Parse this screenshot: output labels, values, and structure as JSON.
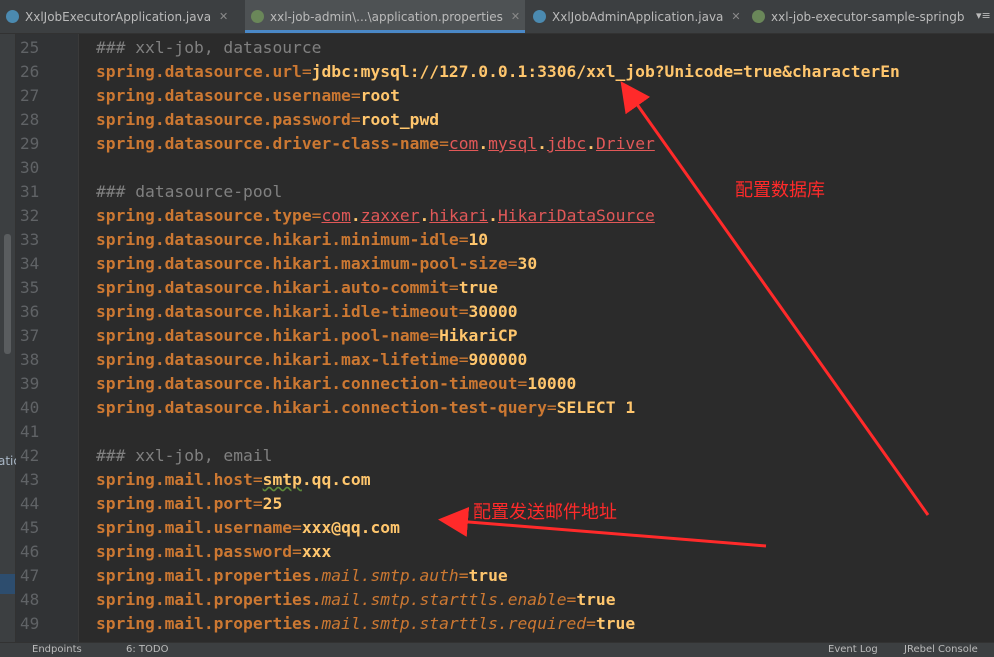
{
  "tabs": [
    {
      "label": "XxlJobExecutorApplication.java",
      "icon": "java-class-icon",
      "active": false
    },
    {
      "label": "xxl-job-admin\\...\\application.properties",
      "icon": "properties-file-icon",
      "active": true
    },
    {
      "label": "XxlJobAdminApplication.java",
      "icon": "java-class-icon",
      "active": false
    },
    {
      "label": "xxl-job-executor-sample-springb",
      "icon": "properties-file-icon",
      "active": false
    }
  ],
  "colors": {
    "annotation": "#ff2a2a",
    "key": "#cc7832",
    "value": "#ffc66d",
    "comment": "#808080",
    "error_ref": "#e15858"
  },
  "side_text": "atic",
  "lines": [
    {
      "no": "25",
      "parts": [
        {
          "cls": "c",
          "t": "### xxl-job, datasource"
        }
      ]
    },
    {
      "no": "26",
      "parts": [
        {
          "cls": "k",
          "t": "spring.datasource.url"
        },
        {
          "cls": "eq",
          "t": "="
        },
        {
          "cls": "v",
          "t": "jdbc:mysql://127.0.0.1:3306/xxl_job?Unicode=true&characterEn"
        }
      ]
    },
    {
      "no": "27",
      "parts": [
        {
          "cls": "k",
          "t": "spring.datasource.username"
        },
        {
          "cls": "eq",
          "t": "="
        },
        {
          "cls": "v",
          "t": "root"
        }
      ]
    },
    {
      "no": "28",
      "parts": [
        {
          "cls": "k",
          "t": "spring.datasource.password"
        },
        {
          "cls": "eq",
          "t": "="
        },
        {
          "cls": "v",
          "t": "root_pwd"
        }
      ]
    },
    {
      "no": "29",
      "parts": [
        {
          "cls": "k",
          "t": "spring.datasource.driver-class-name"
        },
        {
          "cls": "eq",
          "t": "="
        },
        {
          "cls": "err",
          "t": "com"
        },
        {
          "cls": "v",
          "t": "."
        },
        {
          "cls": "err",
          "t": "mysql"
        },
        {
          "cls": "v",
          "t": "."
        },
        {
          "cls": "err",
          "t": "jdbc"
        },
        {
          "cls": "v",
          "t": "."
        },
        {
          "cls": "err",
          "t": "Driver"
        }
      ]
    },
    {
      "no": "30",
      "parts": []
    },
    {
      "no": "31",
      "parts": [
        {
          "cls": "c",
          "t": "### datasource-pool"
        }
      ]
    },
    {
      "no": "32",
      "parts": [
        {
          "cls": "k",
          "t": "spring.datasource.type"
        },
        {
          "cls": "eq",
          "t": "="
        },
        {
          "cls": "err",
          "t": "com"
        },
        {
          "cls": "v",
          "t": "."
        },
        {
          "cls": "err",
          "t": "zaxxer"
        },
        {
          "cls": "v",
          "t": "."
        },
        {
          "cls": "err",
          "t": "hikari"
        },
        {
          "cls": "v",
          "t": "."
        },
        {
          "cls": "err",
          "t": "HikariDataSource"
        }
      ]
    },
    {
      "no": "33",
      "parts": [
        {
          "cls": "k",
          "t": "spring.datasource.hikari.minimum-idle"
        },
        {
          "cls": "eq",
          "t": "="
        },
        {
          "cls": "v",
          "t": "10"
        }
      ]
    },
    {
      "no": "34",
      "parts": [
        {
          "cls": "k",
          "t": "spring.datasource.hikari.maximum-pool-size"
        },
        {
          "cls": "eq",
          "t": "="
        },
        {
          "cls": "v",
          "t": "30"
        }
      ]
    },
    {
      "no": "35",
      "parts": [
        {
          "cls": "k",
          "t": "spring.datasource.hikari.auto-commit"
        },
        {
          "cls": "eq",
          "t": "="
        },
        {
          "cls": "v",
          "t": "true"
        }
      ]
    },
    {
      "no": "36",
      "parts": [
        {
          "cls": "k",
          "t": "spring.datasource.hikari.idle-timeout"
        },
        {
          "cls": "eq",
          "t": "="
        },
        {
          "cls": "v",
          "t": "30000"
        }
      ]
    },
    {
      "no": "37",
      "parts": [
        {
          "cls": "k",
          "t": "spring.datasource.hikari.pool-name"
        },
        {
          "cls": "eq",
          "t": "="
        },
        {
          "cls": "v",
          "t": "HikariCP"
        }
      ]
    },
    {
      "no": "38",
      "parts": [
        {
          "cls": "k",
          "t": "spring.datasource.hikari.max-lifetime"
        },
        {
          "cls": "eq",
          "t": "="
        },
        {
          "cls": "v",
          "t": "900000"
        }
      ]
    },
    {
      "no": "39",
      "parts": [
        {
          "cls": "k",
          "t": "spring.datasource.hikari.connection-timeout"
        },
        {
          "cls": "eq",
          "t": "="
        },
        {
          "cls": "v",
          "t": "10000"
        }
      ]
    },
    {
      "no": "40",
      "parts": [
        {
          "cls": "k",
          "t": "spring.datasource.hikari.connection-test-query"
        },
        {
          "cls": "eq",
          "t": "="
        },
        {
          "cls": "v",
          "t": "SELECT 1"
        }
      ]
    },
    {
      "no": "41",
      "parts": []
    },
    {
      "no": "42",
      "parts": [
        {
          "cls": "c",
          "t": "### xxl-job, email"
        }
      ]
    },
    {
      "no": "43",
      "parts": [
        {
          "cls": "k",
          "t": "spring.mail.host"
        },
        {
          "cls": "eq",
          "t": "="
        },
        {
          "cls": "v sq",
          "t": "smtp"
        },
        {
          "cls": "v",
          "t": ".qq.com"
        }
      ]
    },
    {
      "no": "44",
      "parts": [
        {
          "cls": "k",
          "t": "spring.mail.port"
        },
        {
          "cls": "eq",
          "t": "="
        },
        {
          "cls": "v",
          "t": "25"
        }
      ]
    },
    {
      "no": "45",
      "parts": [
        {
          "cls": "k",
          "t": "spring.mail.username"
        },
        {
          "cls": "eq",
          "t": "="
        },
        {
          "cls": "v",
          "t": "xxx@qq.com"
        }
      ]
    },
    {
      "no": "46",
      "parts": [
        {
          "cls": "k",
          "t": "spring.mail.password"
        },
        {
          "cls": "eq",
          "t": "="
        },
        {
          "cls": "v",
          "t": "xxx"
        }
      ]
    },
    {
      "no": "47",
      "parts": [
        {
          "cls": "k",
          "t": "spring.mail.properties."
        },
        {
          "cls": "it",
          "t": "mail.smtp.auth"
        },
        {
          "cls": "eq",
          "t": "="
        },
        {
          "cls": "v",
          "t": "true"
        }
      ]
    },
    {
      "no": "48",
      "parts": [
        {
          "cls": "k",
          "t": "spring.mail.properties."
        },
        {
          "cls": "it",
          "t": "mail.smtp.starttls.enable"
        },
        {
          "cls": "eq",
          "t": "="
        },
        {
          "cls": "v",
          "t": "true"
        }
      ]
    },
    {
      "no": "49",
      "parts": [
        {
          "cls": "k",
          "t": "spring.mail.properties."
        },
        {
          "cls": "it",
          "t": "mail.smtp.starttls.required"
        },
        {
          "cls": "eq",
          "t": "="
        },
        {
          "cls": "v",
          "t": "true"
        }
      ]
    }
  ],
  "annotations": {
    "datasource": "配置数据库",
    "mail": "配置发送邮件地址"
  },
  "statusbar": {
    "items": [
      "Endpoints",
      "6: TODO",
      "Event Log",
      "JRebel Console"
    ]
  }
}
